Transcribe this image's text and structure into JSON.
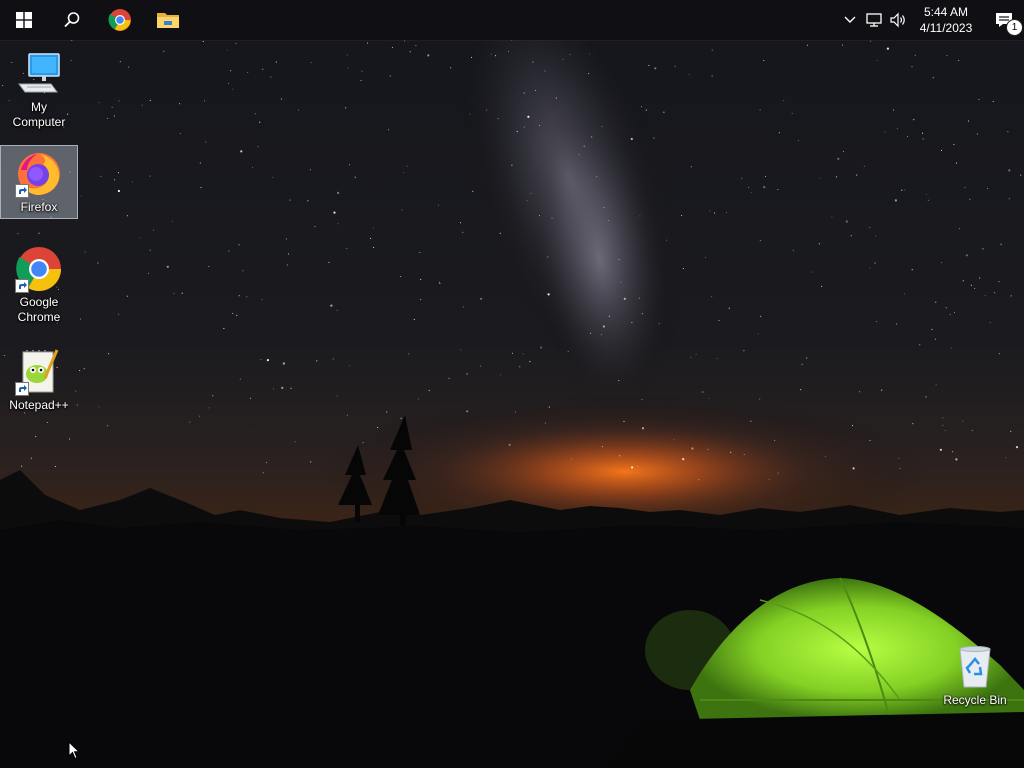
{
  "taskbar": {
    "pinned": [
      {
        "name": "Start",
        "icon": "windows-logo-icon"
      },
      {
        "name": "Search",
        "icon": "search-icon"
      },
      {
        "name": "Google Chrome",
        "icon": "chrome-icon"
      },
      {
        "name": "File Explorer",
        "icon": "folder-icon"
      }
    ],
    "tray": {
      "icons": [
        "chevron-up-icon",
        "network-icon",
        "volume-icon"
      ],
      "time": "5:44 AM",
      "date": "4/11/2023",
      "notification_count": "1"
    }
  },
  "desktop": {
    "icons": [
      {
        "label": "My Computer",
        "icon": "computer-icon"
      },
      {
        "label": "Firefox",
        "icon": "firefox-icon"
      },
      {
        "label": "Google Chrome",
        "icon": "chrome-icon"
      },
      {
        "label": "Notepad++",
        "icon": "notepad-plus-plus-icon"
      },
      {
        "label": "Recycle Bin",
        "icon": "recycle-bin-icon"
      }
    ]
  },
  "colors": {
    "taskbar": "#101014",
    "sky_top": "#15161c",
    "horizon_glow": "#e06a1a",
    "tent_green": "#8fe12c",
    "selection": "#b4bece"
  }
}
